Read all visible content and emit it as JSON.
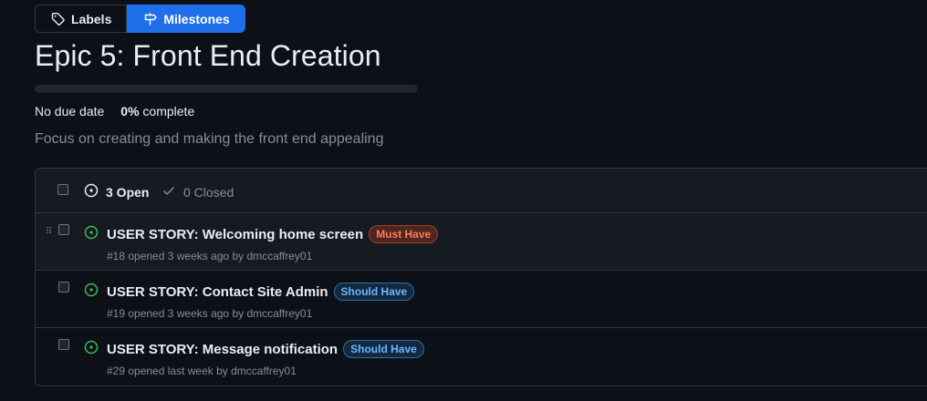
{
  "tabs": {
    "labels": {
      "label": "Labels",
      "icon": "tag-icon"
    },
    "milestones": {
      "label": "Milestones",
      "icon": "milestone-icon",
      "active": true
    }
  },
  "milestone": {
    "title": "Epic 5: Front End Creation",
    "progress": 0,
    "due": "No due date",
    "percent": "0%",
    "complete_word": "complete",
    "description": "Focus on creating and making the front end appealing"
  },
  "issues_header": {
    "open_label": "3 Open",
    "closed_label": "0 Closed"
  },
  "issues": [
    {
      "title": "USER STORY: Welcoming home screen",
      "label": "Must Have",
      "label_color": "#ff7b5c",
      "meta": "#18 opened 3 weeks ago by dmccaffrey01"
    },
    {
      "title": "USER STORY: Contact Site Admin",
      "label": "Should Have",
      "label_color": "#6cb6ff",
      "meta": "#19 opened 3 weeks ago by dmccaffrey01"
    },
    {
      "title": "USER STORY: Message notification",
      "label": "Should Have",
      "label_color": "#6cb6ff",
      "meta": "#29 opened last week by dmccaffrey01"
    }
  ],
  "colors": {
    "background": "#0d1117",
    "accent": "#1f6feb",
    "open_icon": "#3fb950",
    "must_have": "#ff7b5c",
    "should_have": "#6cb6ff"
  }
}
